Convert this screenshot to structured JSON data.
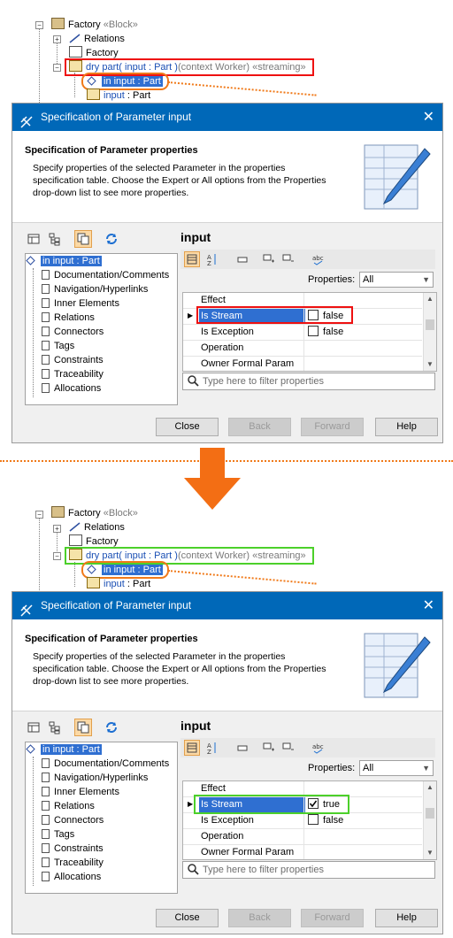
{
  "top": {
    "tree": {
      "factory_block": "Factory",
      "factory_stereo": "«Block»",
      "relations": "Relations",
      "factory": "Factory",
      "op_name": "dry part(",
      "op_param": "input",
      "op_rest": ": Part )",
      "op_ctx": "(context Worker) «streaming»",
      "param_selected": "in input : Part",
      "input_part_name": "input",
      "input_part_type": ": Part"
    },
    "dialog": {
      "title": "Specification of Parameter input",
      "header_title": "Specification of Parameter properties",
      "header_desc": "Specify properties of the selected Parameter in the properties specification table. Choose the Expert or All options from the Properties drop-down list to see more properties.",
      "right_title": "input",
      "properties_label": "Properties:",
      "properties_value": "All",
      "filter_placeholder": "Type here to filter properties",
      "tree_items": [
        "in input : Part",
        "Documentation/Comments",
        "Navigation/Hyperlinks",
        "Inner Elements",
        "Relations",
        "Connectors",
        "Tags",
        "Constraints",
        "Traceability",
        "Allocations"
      ],
      "rows": [
        {
          "name": "Effect",
          "value": ""
        },
        {
          "name": "Is Stream",
          "value": "false",
          "checkbox": true,
          "checked": false
        },
        {
          "name": "Is Exception",
          "value": "false",
          "checkbox": true,
          "checked": false
        },
        {
          "name": "Operation",
          "value": ""
        },
        {
          "name": "Owner Formal Param",
          "value": ""
        }
      ],
      "buttons": {
        "close": "Close",
        "back": "Back",
        "forward": "Forward",
        "help": "Help"
      }
    }
  },
  "bottom": {
    "tree": {
      "factory_block": "Factory",
      "factory_stereo": "«Block»",
      "relations": "Relations",
      "factory": "Factory",
      "op_name": "dry part(",
      "op_param": "input",
      "op_rest": ": Part )",
      "op_ctx": "(context Worker) «streaming»",
      "param_selected": "in input : Part",
      "input_part_name": "input",
      "input_part_type": ": Part"
    },
    "dialog": {
      "title": "Specification of Parameter input",
      "header_title": "Specification of Parameter properties",
      "header_desc": "Specify properties of the selected Parameter in the properties specification table. Choose the Expert or All options from the Properties drop-down list to see more properties.",
      "right_title": "input",
      "properties_label": "Properties:",
      "properties_value": "All",
      "filter_placeholder": "Type here to filter properties",
      "tree_items": [
        "in input : Part",
        "Documentation/Comments",
        "Navigation/Hyperlinks",
        "Inner Elements",
        "Relations",
        "Connectors",
        "Tags",
        "Constraints",
        "Traceability",
        "Allocations"
      ],
      "rows": [
        {
          "name": "Effect",
          "value": ""
        },
        {
          "name": "Is Stream",
          "value": "true",
          "checkbox": true,
          "checked": true
        },
        {
          "name": "Is Exception",
          "value": "false",
          "checkbox": true,
          "checked": false
        },
        {
          "name": "Operation",
          "value": ""
        },
        {
          "name": "Owner Formal Param",
          "value": ""
        }
      ],
      "buttons": {
        "close": "Close",
        "back": "Back",
        "forward": "Forward",
        "help": "Help"
      }
    }
  },
  "colors": {
    "title_bar": "#0068b8",
    "selection": "#2f6fd1",
    "highlight_before": "#ee1111",
    "highlight_after": "#4cd02a",
    "callout": "#f07a1a"
  }
}
